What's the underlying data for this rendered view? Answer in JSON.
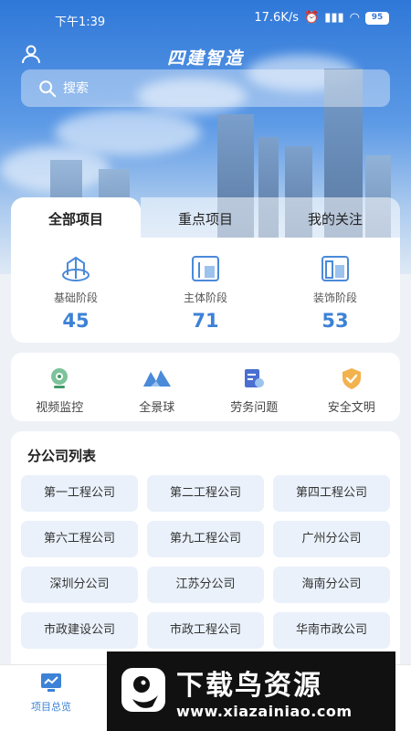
{
  "status_bar": {
    "time": "下午1:39",
    "network_speed": "17.6K/s",
    "battery": "95"
  },
  "header": {
    "title": "四建智造",
    "search_placeholder": "搜索"
  },
  "tabs": [
    {
      "label": "全部项目",
      "active": true
    },
    {
      "label": "重点项目",
      "active": false
    },
    {
      "label": "我的关注",
      "active": false
    }
  ],
  "stages": [
    {
      "label": "基础阶段",
      "count": "45",
      "icon": "foundation-icon"
    },
    {
      "label": "主体阶段",
      "count": "71",
      "icon": "main-structure-icon"
    },
    {
      "label": "装饰阶段",
      "count": "53",
      "icon": "decoration-icon"
    }
  ],
  "tools": [
    {
      "label": "视频监控",
      "icon": "camera-icon"
    },
    {
      "label": "全景球",
      "icon": "panorama-icon"
    },
    {
      "label": "劳务问题",
      "icon": "labor-icon"
    },
    {
      "label": "安全文明",
      "icon": "shield-icon"
    }
  ],
  "branch_list": {
    "title": "分公司列表",
    "items": [
      "第一工程公司",
      "第二工程公司",
      "第四工程公司",
      "第六工程公司",
      "第九工程公司",
      "广州分公司",
      "深圳分公司",
      "江苏分公司",
      "海南分公司",
      "市政建设公司",
      "市政工程公司",
      "华南市政公司"
    ]
  },
  "bottom_nav": {
    "items": [
      {
        "label": "项目总览",
        "active": true
      }
    ]
  },
  "watermark": {
    "brand": "下载鸟资源",
    "url": "www.xiazainiao.com"
  },
  "colors": {
    "accent": "#3d82d6",
    "chip_bg": "#eaf1fa",
    "card_bg": "#ffffff"
  }
}
